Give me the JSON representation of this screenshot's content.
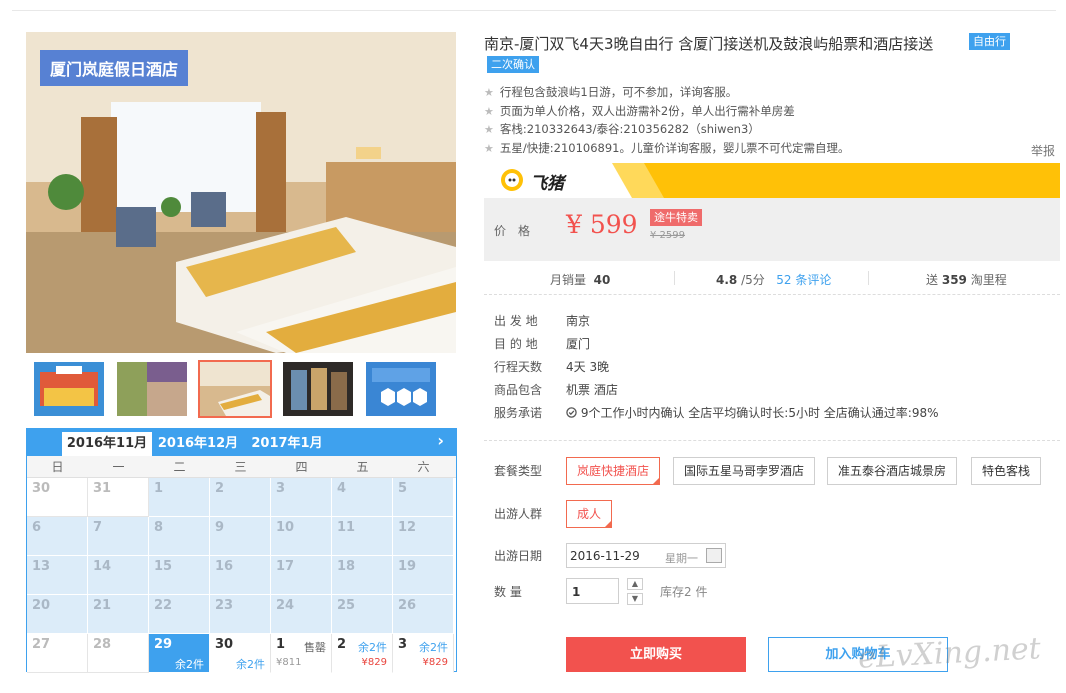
{
  "gallery": {
    "title_overlay": "厦门岚庭假日酒店",
    "thumbnails": [
      "thumb-1",
      "thumb-2",
      "thumb-3",
      "thumb-4",
      "thumb-5"
    ],
    "active_thumb_index": 2
  },
  "calendar": {
    "tabs": [
      "2016年11月",
      "2016年12月",
      "2017年1月"
    ],
    "next_icon": "›",
    "weekdays": [
      "日",
      "一",
      "二",
      "三",
      "四",
      "五",
      "六"
    ],
    "rows": [
      [
        {
          "d": "30"
        },
        {
          "d": "31"
        },
        {
          "d": "1"
        },
        {
          "d": "2"
        },
        {
          "d": "3"
        },
        {
          "d": "4"
        },
        {
          "d": "5"
        }
      ],
      [
        {
          "d": "6"
        },
        {
          "d": "7"
        },
        {
          "d": "8"
        },
        {
          "d": "9"
        },
        {
          "d": "10"
        },
        {
          "d": "11"
        },
        {
          "d": "12"
        }
      ],
      [
        {
          "d": "13"
        },
        {
          "d": "14"
        },
        {
          "d": "15"
        },
        {
          "d": "16"
        },
        {
          "d": "17"
        },
        {
          "d": "18"
        },
        {
          "d": "19"
        }
      ],
      [
        {
          "d": "20"
        },
        {
          "d": "21"
        },
        {
          "d": "22"
        },
        {
          "d": "23"
        },
        {
          "d": "24"
        },
        {
          "d": "25"
        },
        {
          "d": "26"
        }
      ],
      [
        {
          "d": "27"
        },
        {
          "d": "28"
        },
        {
          "d": "29",
          "status": "余2件"
        },
        {
          "d": "30",
          "status": "余2件"
        },
        {
          "d": "1",
          "status": "售罄",
          "price": "¥811"
        },
        {
          "d": "2",
          "status": "余2件",
          "price": "¥829"
        },
        {
          "d": "3",
          "status": "余2件",
          "price": "¥829"
        }
      ]
    ]
  },
  "product": {
    "title": "南京-厦门双飞4天3晚自由行 含厦门接送机及鼓浪屿船票和酒店接送",
    "tag_type": "自由行",
    "tag_confirm": "二次确认",
    "notes": [
      "行程包含鼓浪屿1日游，可不参加，详询客服。",
      "页面为单人价格，双人出游需补2份，单人出行需补单房差",
      "客栈:210332643/泰谷:210356282（shiwen3）",
      "五星/快捷:210106891。儿童价详询客服，婴儿票不可代定需自理。"
    ],
    "report": "举报"
  },
  "seller": {
    "name": "飞猪",
    "logo_icon": "pig-logo-icon"
  },
  "price": {
    "label": "价格",
    "value": "¥ 599",
    "badge": "途牛特卖",
    "old": "¥ 2599"
  },
  "stats": {
    "monthly_sales_label": "月销量",
    "monthly_sales": "40",
    "rating": "4.8",
    "rating_suffix": "/5分",
    "reviews_count": "52",
    "reviews_label": "条评论",
    "gift_prefix": "送",
    "mileage": "359",
    "gift_suffix": "淘里程"
  },
  "info": {
    "rows": [
      {
        "key": "出 发 地",
        "value": "南京"
      },
      {
        "key": "目 的 地",
        "value": "厦门"
      },
      {
        "key": "行程天数",
        "value": "4天 3晚"
      },
      {
        "key": "商品包含",
        "value": "机票   酒店"
      },
      {
        "key": "服务承诺",
        "value": "9个工作小时内确认    全店平均确认时长:5小时    全店确认通过率:98%"
      }
    ],
    "promise_icon": "check-circle-icon"
  },
  "options": {
    "package_label": "套餐类型",
    "packages": [
      "岚庭快捷酒店",
      "国际五星马哥孛罗酒店",
      "准五泰谷酒店城景房",
      "特色客栈"
    ],
    "crowd_label": "出游人群",
    "crowd": [
      "成人"
    ],
    "date_label": "出游日期",
    "date_value": "2016-11-29",
    "date_weekday": "星期一",
    "date_icon": "calendar-icon",
    "qty_label": "数  量",
    "qty_value": "1",
    "stock": "库存2 件"
  },
  "actions": {
    "buy": "立即购买",
    "cart": "加入购物车"
  },
  "watermark": "eLvXing.net",
  "colors": {
    "accent_blue": "#3ea1ee",
    "price_red": "#f2524e",
    "brand_yellow": "#ffc107"
  }
}
